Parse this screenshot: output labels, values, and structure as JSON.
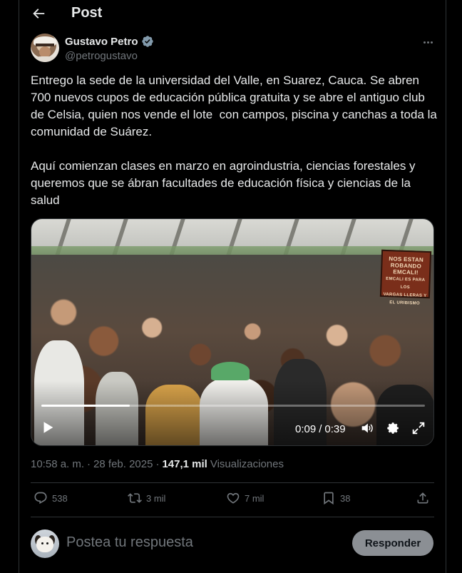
{
  "header": {
    "title": "Post"
  },
  "author": {
    "name": "Gustavo Petro",
    "handle": "@petrogustavo"
  },
  "tweet": {
    "paragraphs": [
      "Entrego la sede de la universidad del Valle, en Suarez, Cauca. Se abren 700 nuevos cupos de educación pública gratuita y se abre el antiguo club de Celsia, quien nos vende el lote  con campos, piscina y canchas a toda la comunidad de Suárez.",
      "Aquí comienzan clases en marzo en agroindustria, ciencias forestales y queremos que se ábran facultades de educación física y ciencias de la salud"
    ]
  },
  "video": {
    "current_time": "0:09",
    "separator": "/",
    "duration": "0:39",
    "progress_fraction": 0.23,
    "sign_text": [
      "NOS ESTAN",
      "ROBANDO",
      "EMCALI!",
      "EMCALI ES PARA LOS",
      "VARGAS LLERAS Y",
      "EL URIBISMO"
    ]
  },
  "meta": {
    "time": "10:58 a. m.",
    "dot": "·",
    "date": "28 feb. 2025",
    "views_count": "147,1 mil",
    "views_label": "Visualizaciones"
  },
  "actions": {
    "replies": "538",
    "reposts": "3 mil",
    "likes": "7 mil",
    "bookmarks": "38"
  },
  "reply": {
    "placeholder": "Postea tu respuesta",
    "button_label": "Responder"
  },
  "icons": {
    "back": "arrow-left-icon",
    "verified": "verified-badge-icon",
    "more": "more-icon",
    "play": "play-icon",
    "volume": "volume-icon",
    "settings": "gear-icon",
    "fullscreen": "expand-icon",
    "reply": "reply-icon",
    "repost": "repost-icon",
    "like": "heart-icon",
    "bookmark": "bookmark-icon",
    "share": "share-icon"
  },
  "colors": {
    "background": "#000000",
    "text": "#e7e9ea",
    "muted": "#71767b",
    "border": "#2f3336",
    "verified": "#829aab",
    "reply_button": "#8b8f94"
  }
}
